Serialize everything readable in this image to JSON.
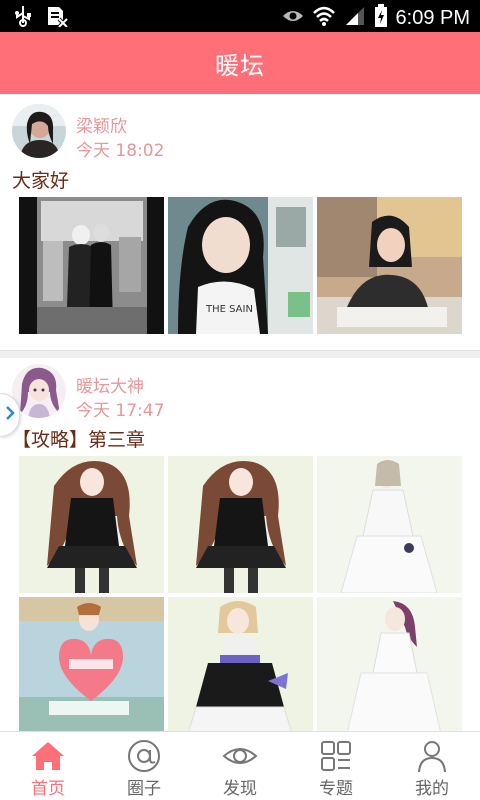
{
  "status_bar": {
    "time": "6:09 PM",
    "icons": [
      "usb-icon",
      "image-cancel-icon",
      "eye-icon",
      "wifi-icon",
      "signal-icon",
      "battery-charging-icon"
    ]
  },
  "header": {
    "title": "暖坛"
  },
  "posts": [
    {
      "author": "梁颖欣",
      "time": "今天 18:02",
      "text": "大家好",
      "images": [
        "mirror-photo",
        "selfie-photo",
        "portrait-photo"
      ]
    },
    {
      "author": "暖坛大神",
      "time": "今天 17:47",
      "text": "【攻略】第三章",
      "images": [
        "dress-black-1",
        "dress-black-2",
        "dress-white-1",
        "heart-card",
        "gown-black-white",
        "dress-white-2"
      ]
    }
  ],
  "tabs": [
    {
      "label": "首页",
      "icon": "home-icon",
      "active": true
    },
    {
      "label": "圈子",
      "icon": "at-sign-icon",
      "active": false
    },
    {
      "label": "发现",
      "icon": "eye-icon",
      "active": false
    },
    {
      "label": "专题",
      "icon": "grid-icon",
      "active": false
    },
    {
      "label": "我的",
      "icon": "person-icon",
      "active": false
    }
  ],
  "colors": {
    "accent": "#ff6f77",
    "meta_text": "#e79799",
    "post_text": "#6a2b17"
  }
}
